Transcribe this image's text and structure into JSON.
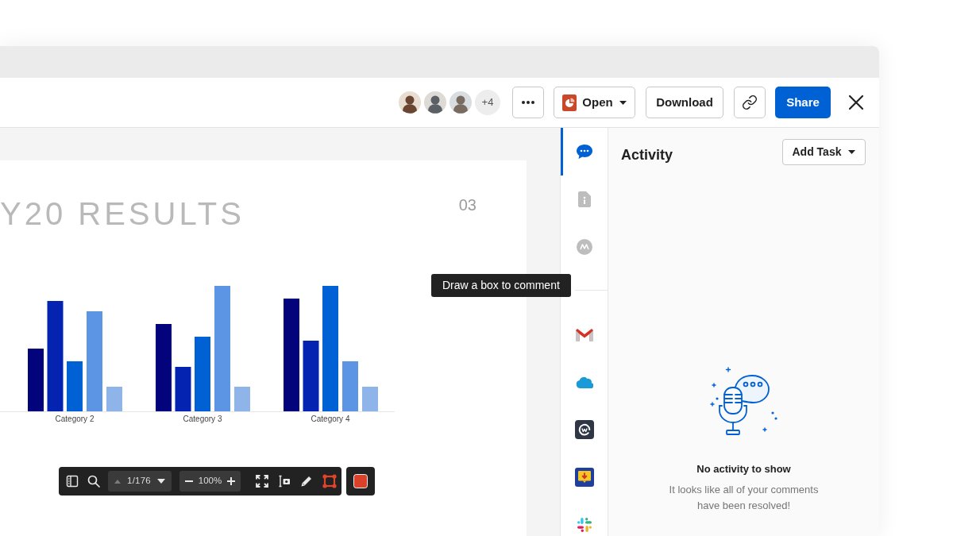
{
  "header": {
    "collaborators": {
      "overflow_count": "+4"
    },
    "actions": [
      {
        "kind": "more"
      },
      {
        "kind": "open",
        "label": "Open"
      },
      {
        "kind": "download",
        "label": "Download"
      },
      {
        "kind": "link"
      },
      {
        "kind": "share",
        "label": "Share"
      },
      {
        "kind": "close"
      }
    ]
  },
  "slide": {
    "title": "Y20 RESULTS",
    "page_number": "03",
    "chart": {
      "categories": [
        "Category 2",
        "Category 3",
        "Category 4"
      ]
    }
  },
  "tooltip": {
    "text": "Draw a box to comment"
  },
  "viewer_toolbar": {
    "left_tools": [
      {
        "kind": "thumbnails"
      },
      {
        "kind": "search"
      }
    ],
    "page": {
      "label": "1/176",
      "previous_disabled": true
    },
    "zoom": {
      "label": "100%"
    },
    "right_tools": [
      {
        "kind": "fullscreen",
        "selected": false
      },
      {
        "kind": "text_select",
        "selected": false
      },
      {
        "kind": "draw",
        "selected": false
      },
      {
        "kind": "region",
        "selected": true
      }
    ]
  },
  "sidebar": {
    "tabs": [
      {
        "kind": "activity",
        "selected": true
      },
      {
        "kind": "details",
        "selected": false
      },
      {
        "kind": "metadata",
        "selected": false
      }
    ],
    "integrations": [
      {
        "kind": "mail"
      },
      {
        "kind": "cloud"
      },
      {
        "kind": "workplace"
      },
      {
        "kind": "download"
      },
      {
        "kind": "pinwheel"
      }
    ]
  },
  "activity_panel": {
    "title": "Activity",
    "add_task": "Add Task",
    "empty_title": "No activity to show",
    "empty_message": "It looks like all of your comments have been resolved!"
  }
}
